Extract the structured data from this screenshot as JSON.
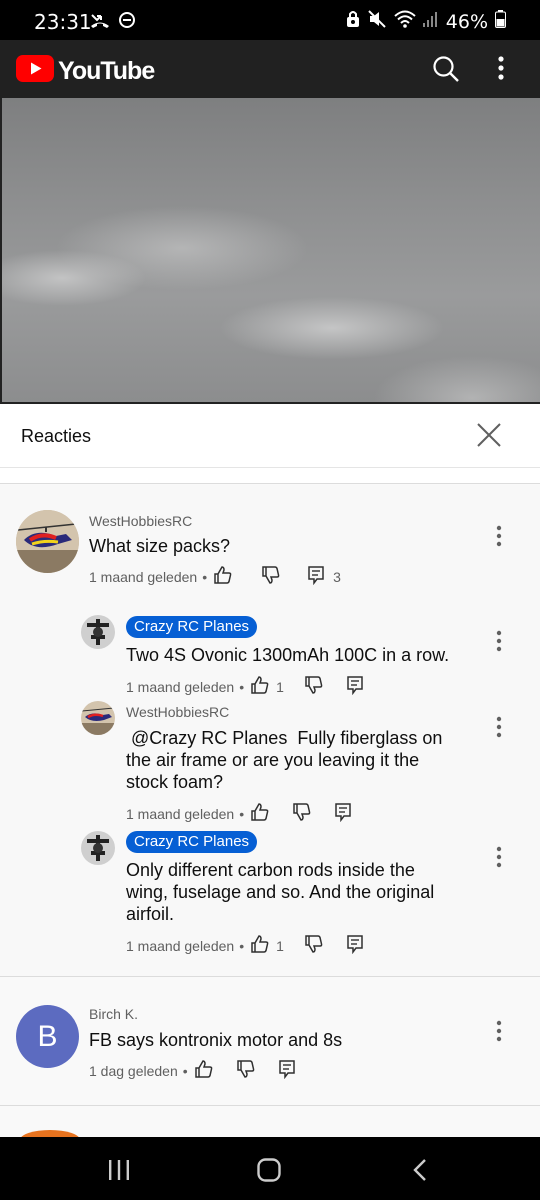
{
  "status_bar": {
    "time": "23:31",
    "battery": "46%",
    "icons": [
      "missed-call-icon",
      "do-not-disturb-icon",
      "lock-icon",
      "mute-icon",
      "wifi-icon",
      "signal-icon",
      "battery-icon"
    ]
  },
  "header": {
    "app_name": "YouTube",
    "icons": [
      "youtube-logo-icon",
      "search-icon",
      "more-vert-icon"
    ]
  },
  "comments_panel": {
    "title": "Reacties",
    "close_icon": "close-icon"
  },
  "comments": [
    {
      "author": "WestHobbiesRC",
      "text": "What size packs?",
      "time": "1 maand geleden",
      "likes": "",
      "replies": "3",
      "avatar": "helicopter"
    }
  ],
  "replies": [
    {
      "author": "Crazy RC Planes",
      "author_badge": true,
      "text": "Two 4S Ovonic 1300mAh 100C in a row.",
      "time": "1 maand geleden",
      "likes": "1"
    },
    {
      "author": "WestHobbiesRC",
      "author_badge": false,
      "text_lines": [
        " @Crazy RC Planes  Fully fiberglass on",
        "the air frame or are you leaving it the",
        "stock foam?"
      ],
      "time": "1 maand geleden",
      "likes": ""
    },
    {
      "author": "Crazy RC Planes",
      "author_badge": true,
      "text_lines": [
        "Only different carbon rods inside the",
        "wing, fuselage and so. And the original",
        "airfoil."
      ],
      "time": "1 maand geleden",
      "likes": "1"
    }
  ],
  "comment2": {
    "author": "Birch K.",
    "avatar_letter": "B",
    "avatar_color": "#5c6bc0",
    "text": "FB says kontronix motor and 8s",
    "time": "1 dag geleden"
  },
  "separator": "•",
  "colors": {
    "badge": "#065fd4",
    "youtube_red": "#ff0000",
    "header_bg": "#212121"
  },
  "nav_bar": {
    "icons": [
      "recent-apps-icon",
      "home-icon",
      "back-icon"
    ]
  }
}
